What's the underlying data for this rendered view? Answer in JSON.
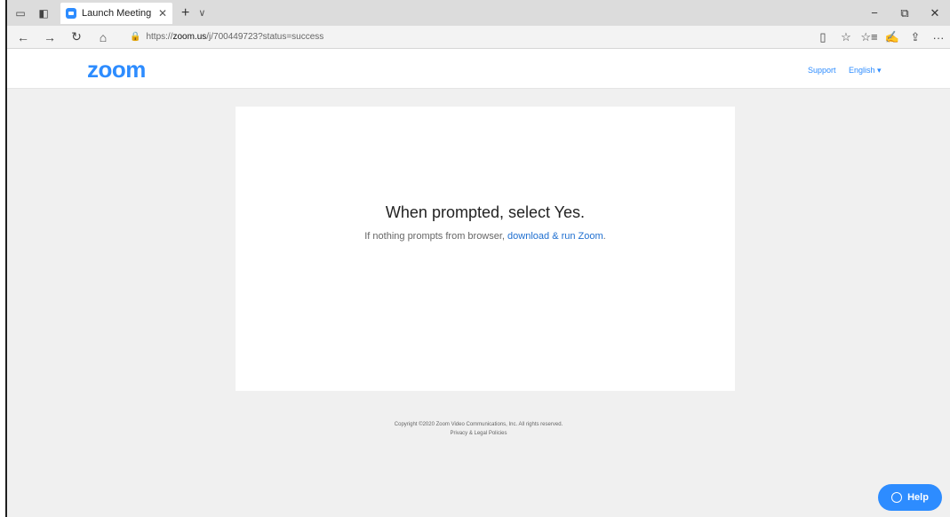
{
  "browser": {
    "tab": {
      "title": "Launch Meeting - Zoom",
      "close": "✕"
    },
    "new_tab": "+",
    "tab_menu": "∨",
    "window_controls": {
      "minimize": "−",
      "restore": "⧉",
      "close": "✕"
    },
    "nav": {
      "back": "←",
      "forward": "→",
      "refresh": "↻",
      "home": "⌂"
    },
    "url": {
      "lock": "🔒",
      "prefix": "https://",
      "domain": "zoom.us",
      "rest": "/j/700449723?status=success"
    },
    "right_icons": {
      "reading": "▯",
      "favorite": "☆",
      "favorites_bar": "☆≡",
      "pen": "✍",
      "share": "⇪",
      "more": "···"
    }
  },
  "zoom": {
    "logo": "zoom",
    "support": "Support",
    "language": "English ▾"
  },
  "card": {
    "title": "When prompted, select Yes.",
    "sub_text": "If nothing prompts from browser, ",
    "sub_link": "download & run Zoom",
    "sub_end": "."
  },
  "footer": {
    "copyright": "Copyright ©2020 Zoom Video Communications, Inc. All rights reserved.",
    "policies": "Privacy & Legal Policies"
  },
  "help": {
    "label": "Help"
  },
  "colors": {
    "brand": "#2d8cff",
    "link": "#1f6fd0",
    "page_bg": "#f0f0f0"
  }
}
